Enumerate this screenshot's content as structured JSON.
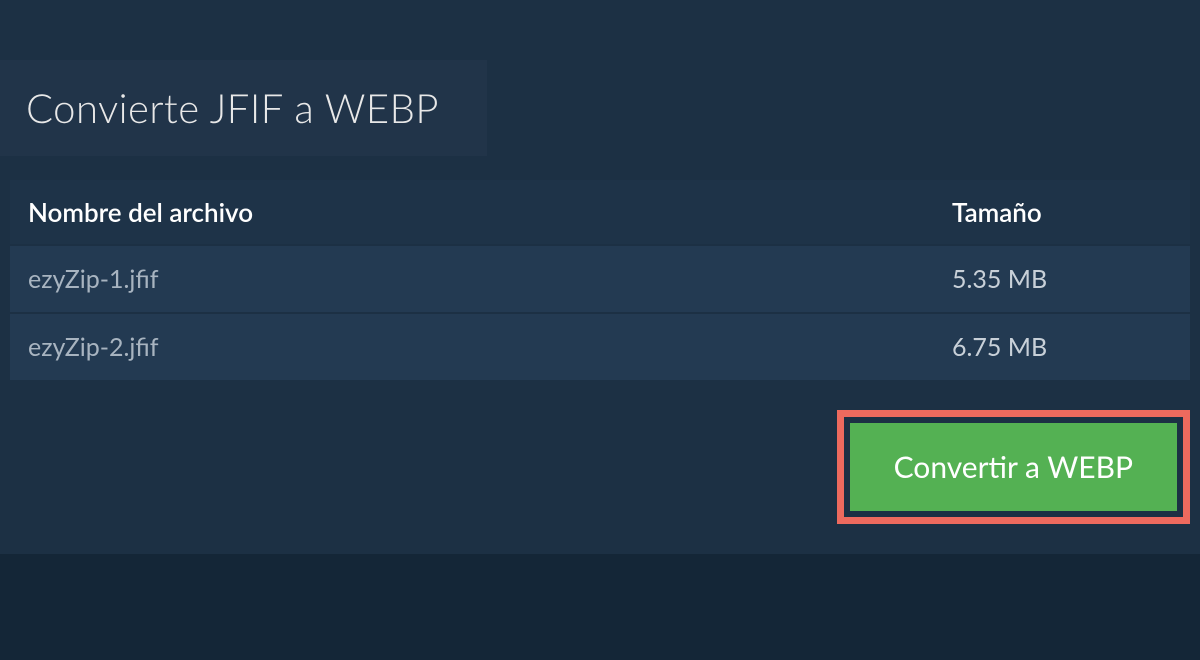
{
  "tab": {
    "title": "Convierte JFIF a WEBP"
  },
  "table": {
    "header": {
      "filename": "Nombre del archivo",
      "size": "Tamaño"
    },
    "rows": [
      {
        "filename": "ezyZip-1.jfif",
        "size": "5.35 MB"
      },
      {
        "filename": "ezyZip-2.jfif",
        "size": "6.75 MB"
      }
    ]
  },
  "actions": {
    "convert_label": "Convertir a WEBP"
  },
  "colors": {
    "background_page": "#142637",
    "background_panel": "#1c3044",
    "background_tab": "#213449",
    "background_header": "#1e3348",
    "background_row": "#233a52",
    "button_green": "#54b153",
    "highlight_border": "#ed6a5e"
  }
}
